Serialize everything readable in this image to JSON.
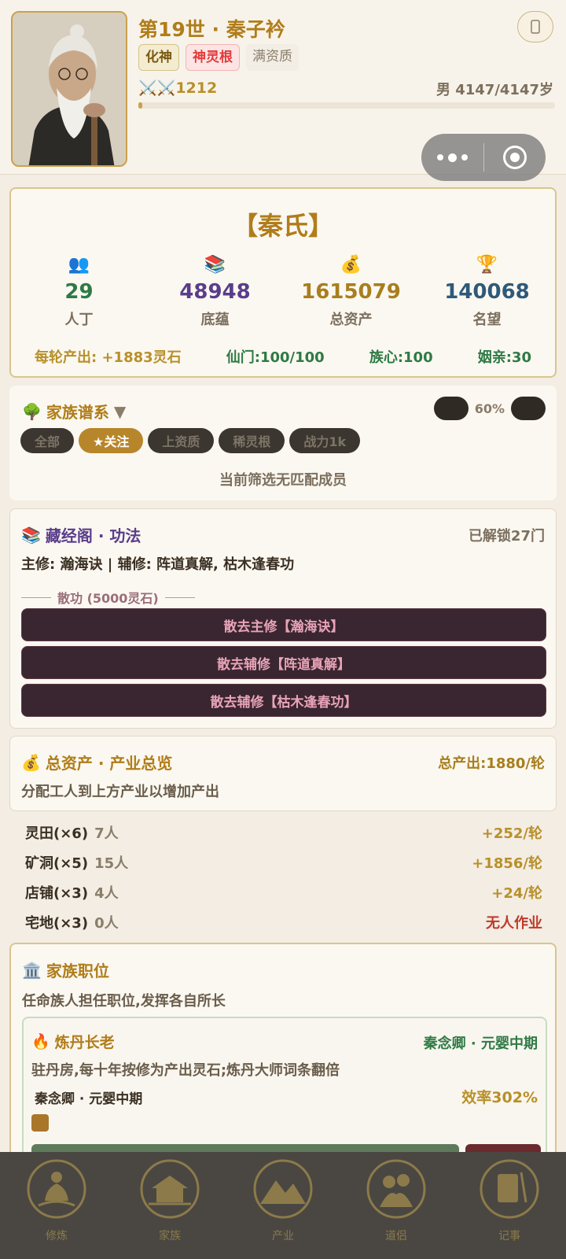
{
  "header": {
    "title": "第19世 · 秦子衿",
    "tags": [
      "化神",
      "神灵根",
      "满资质"
    ],
    "power": "⚔️⚔️1212",
    "age": "男 4147/4147岁",
    "lifespan_fraction": 0.01,
    "avatar_icon": "elder-portrait"
  },
  "capsule": {
    "more_icon": "more-dots-icon",
    "close_icon": "target-icon"
  },
  "clan": {
    "name": "【秦氏】",
    "stats": [
      {
        "icon": "👥",
        "value": "29",
        "label": "人丁",
        "color": "#2e7a45"
      },
      {
        "icon": "📚",
        "value": "48948",
        "label": "底蕴",
        "color": "#5a3d8a"
      },
      {
        "icon": "💰",
        "value": "1615079",
        "label": "总资产",
        "color": "#a87e1e"
      },
      {
        "icon": "🏆",
        "value": "140068",
        "label": "名望",
        "color": "#2e5a7a"
      }
    ],
    "output": "每轮产出: +1883灵石",
    "sect": "仙门:100/100",
    "loyalty": "族心:100",
    "marriage": "姻亲:30"
  },
  "tree": {
    "icon": "🌳",
    "title": "家族谱系",
    "arrow": "▼",
    "zoom": "60%",
    "filters": [
      "全部",
      "★关注",
      "上资质",
      "稀灵根",
      "战力1k"
    ],
    "active_filter": 1,
    "empty": "当前筛选无匹配成员"
  },
  "library": {
    "icon": "📚",
    "title": "藏经阁 · 功法",
    "unlocked": "已解锁27门",
    "current": "主修: 瀚海诀 | 辅修: 阵道真解, 枯木逢春功",
    "dispel_label": "散功 (5000灵石)",
    "buttons": [
      "散去主修【瀚海诀】",
      "散去辅修【阵道真解】",
      "散去辅修【枯木逢春功】"
    ]
  },
  "assets": {
    "icon": "💰",
    "title": "总资产 · 产业总览",
    "total": "总产出:1880/轮",
    "hint": "分配工人到上方产业以增加产出",
    "rows": [
      {
        "name": "灵田(×6)",
        "count": "7人",
        "output": "+252/轮"
      },
      {
        "name": "矿洞(×5)",
        "count": "15人",
        "output": "+1856/轮"
      },
      {
        "name": "店铺(×3)",
        "count": "4人",
        "output": "+24/轮"
      },
      {
        "name": "宅地(×3)",
        "count": "0人",
        "output": "无人作业"
      }
    ]
  },
  "posts": {
    "icon": "🏛️",
    "title": "家族职位",
    "hint": "任命族人担任职位,发挥各自所长",
    "card": {
      "icon": "🔥",
      "title": "炼丹长老",
      "holder": "秦念卿 · 元婴中期",
      "desc": "驻丹房,每十年按修为产出灵石;炼丹大师词条翻倍",
      "who": "秦念卿 · 元婴中期",
      "efficiency": "效率302%"
    }
  },
  "tabs": [
    {
      "label": "修炼",
      "icon": "meditation-icon"
    },
    {
      "label": "家族",
      "icon": "pavilion-icon"
    },
    {
      "label": "产业",
      "icon": "mountain-icon"
    },
    {
      "label": "道侣",
      "icon": "couple-icon"
    },
    {
      "label": "记事",
      "icon": "scroll-icon"
    }
  ]
}
